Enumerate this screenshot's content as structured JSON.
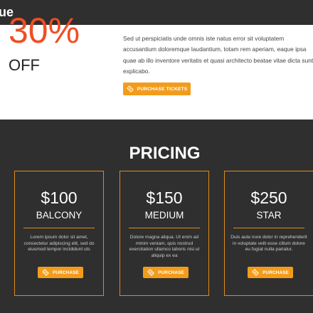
{
  "header": {
    "brand": "ue"
  },
  "hero": {
    "discount": "30%",
    "off": "OFF",
    "description": "Sed ut perspiciatis unde omnis iste natus error sit voluptatem accusantium doloremque laudantium, totam rem aperiam, eaque ipsa quae ab illo inventore veritatis et quasi architecto beatae vitae dicta sunt explicabo.",
    "button_label": "PURCHASE TICKETS"
  },
  "pricing": {
    "title": "PRICING",
    "cards": [
      {
        "price": "$100",
        "tier": "BALCONY",
        "text": "Lorem ipsum dolor sit amet, consectetur adipiscing elit, sed do eiusmod tempor incididunt uts",
        "button_label": "PURCHASE"
      },
      {
        "price": "$150",
        "tier": "MEDIUM",
        "text": "Dolore magna aliqua. Ut enim ad minim veniam, quis nostrud exercitation ullamco laboris nisi ut aliquip ex ea",
        "button_label": "PURCHASE"
      },
      {
        "price": "$250",
        "tier": "STAR",
        "text": "Duis aute irure dolor in reprehenderit in voluptate velit esse cillum dolore eu fugiat nulla pariatur.",
        "button_label": "PURCHASE"
      }
    ]
  },
  "colors": {
    "accent": "#f39c1b",
    "discount": "#f04e23",
    "dark": "#2f2f2f",
    "border": "#e08a18"
  },
  "icons": {
    "ticket": "ticket-icon"
  }
}
